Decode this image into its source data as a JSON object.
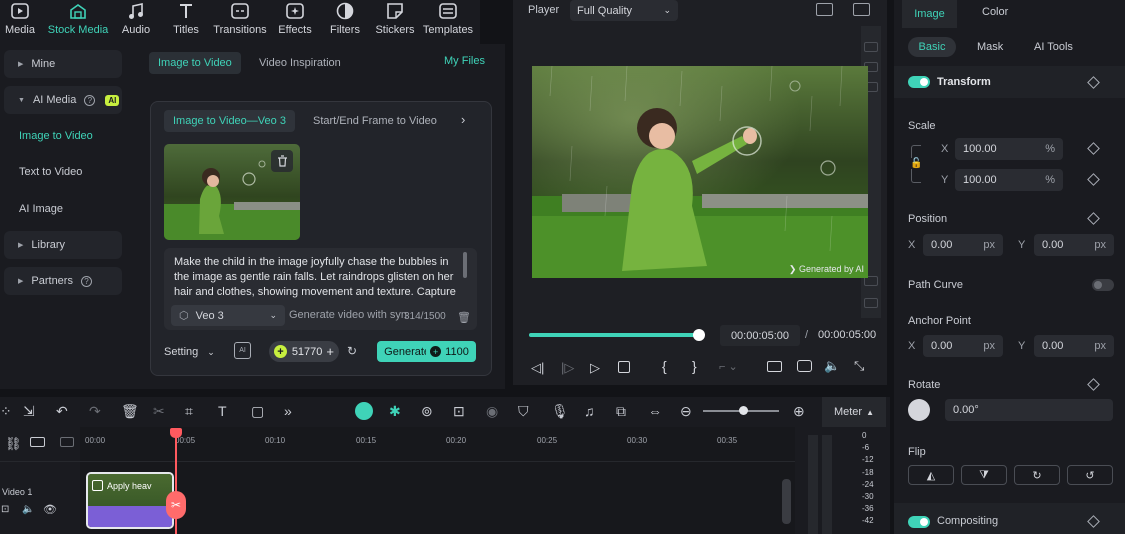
{
  "toolbar": {
    "items": [
      {
        "label": "Media",
        "icon": "media-icon"
      },
      {
        "label": "Stock Media",
        "icon": "stock-media-icon",
        "active": true
      },
      {
        "label": "Audio",
        "icon": "audio-icon"
      },
      {
        "label": "Titles",
        "icon": "titles-icon"
      },
      {
        "label": "Transitions",
        "icon": "transitions-icon"
      },
      {
        "label": "Effects",
        "icon": "effects-icon"
      },
      {
        "label": "Filters",
        "icon": "filters-icon"
      },
      {
        "label": "Stickers",
        "icon": "stickers-icon"
      },
      {
        "label": "Templates",
        "icon": "templates-icon"
      }
    ]
  },
  "leftnav": {
    "mine": "Mine",
    "ai_media": "AI Media",
    "ai_badge": "AI",
    "image_to_video": "Image to Video",
    "text_to_video": "Text to Video",
    "ai_image": "AI Image",
    "library": "Library",
    "partners": "Partners",
    "help_glyph": "?"
  },
  "media": {
    "tabs": [
      "Image to Video",
      "Video Inspiration"
    ],
    "my_files": "My Files",
    "card_tabs": [
      "Image to Video—Veo 3",
      "Start/End Frame to Video"
    ],
    "prompt_text": "Make the child in the image joyfully chase the bubbles in the image as gentle rain falls. Let raindrops glisten on her hair and clothes, showing movement and texture. Capture",
    "model": "Veo 3",
    "generate_with": "Generate video with syn",
    "char_count": "314/1500",
    "setting": "Setting",
    "credits": "51770",
    "generate_label": "Generate",
    "generate_cost": "1100"
  },
  "player": {
    "label": "Player",
    "quality": "Full Quality",
    "watermark": "Generated by AI",
    "progress": 1.0,
    "current_time": "00:00:05:00",
    "separator": "/",
    "total_time": "00:00:05:00"
  },
  "right": {
    "tabs": [
      "Image",
      "Color"
    ],
    "subtabs": [
      "Basic",
      "Mask",
      "AI Tools"
    ],
    "transform": "Transform",
    "scale": "Scale",
    "scale_x": "100.00",
    "scale_y": "100.00",
    "percent": "%",
    "x": "X",
    "y": "Y",
    "position": "Position",
    "pos_x": "0.00",
    "pos_y": "0.00",
    "px": "px",
    "path_curve": "Path Curve",
    "anchor_point": "Anchor Point",
    "anchor_x": "0.00",
    "anchor_y": "0.00",
    "rotate": "Rotate",
    "rotate_value": "0.00°",
    "flip": "Flip",
    "compositing": "Compositing"
  },
  "timeline": {
    "meter": "Meter",
    "ticks": [
      "00:00",
      "00:05",
      "00:10",
      "00:15",
      "00:20",
      "00:25",
      "00:30",
      "00:35"
    ],
    "track_label": "Video 1",
    "clip_label": "Apply heav",
    "meter_levels": [
      "0",
      "-6",
      "-12",
      "-18",
      "-24",
      "-30",
      "-36",
      "-42"
    ]
  },
  "colors": {
    "accent": "#3fd3b8",
    "ai_badge": "#c7ef3f",
    "playhead": "#ff5a5f",
    "clip": "#7b5fd6"
  }
}
